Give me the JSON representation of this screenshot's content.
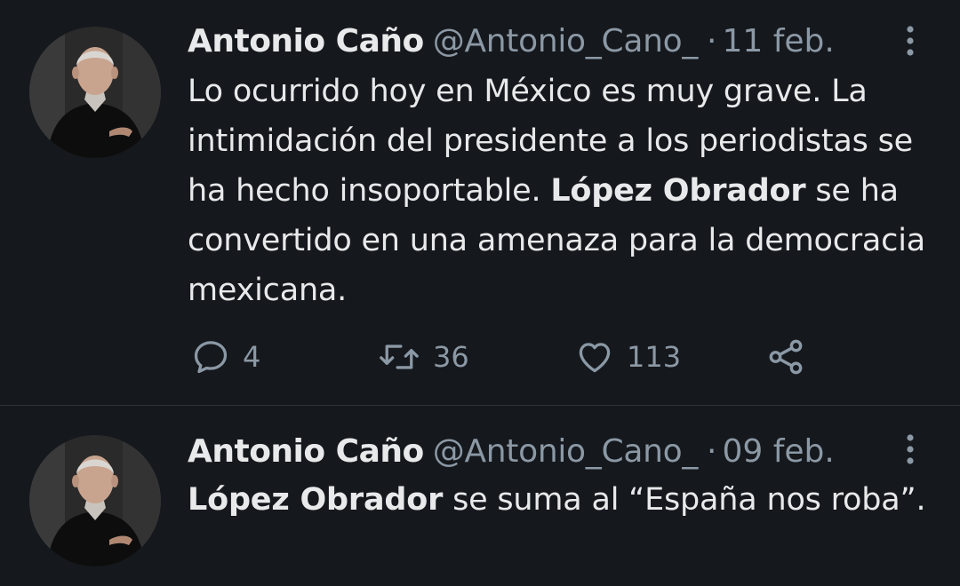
{
  "tweets": [
    {
      "author": {
        "display_name": "Antonio Caño",
        "handle": "@Antonio_Cano_"
      },
      "separator": "·",
      "date": "11 feb.",
      "text_parts": [
        "Lo ocurrido hoy en México es muy grave. La intimidación del presidente a los periodistas se ha hecho insoportable. ",
        "López Obrador",
        " se ha convertido en una amenaza para la democracia mexicana."
      ],
      "stats": {
        "replies": "4",
        "retweets": "36",
        "likes": "113"
      }
    },
    {
      "author": {
        "display_name": "Antonio Caño",
        "handle": "@Antonio_Cano_"
      },
      "separator": "·",
      "date": "09 feb.",
      "text_parts": [
        "López Obrador",
        " se suma al “España nos roba”."
      ]
    }
  ],
  "icons": {
    "more": "more-vertical-icon",
    "reply": "reply-icon",
    "retweet": "retweet-icon",
    "like": "heart-icon",
    "share": "share-icon"
  },
  "colors": {
    "background": "#15181c",
    "text": "#e7e9ea",
    "secondary": "#8b98a5",
    "divider": "#2f3336"
  }
}
